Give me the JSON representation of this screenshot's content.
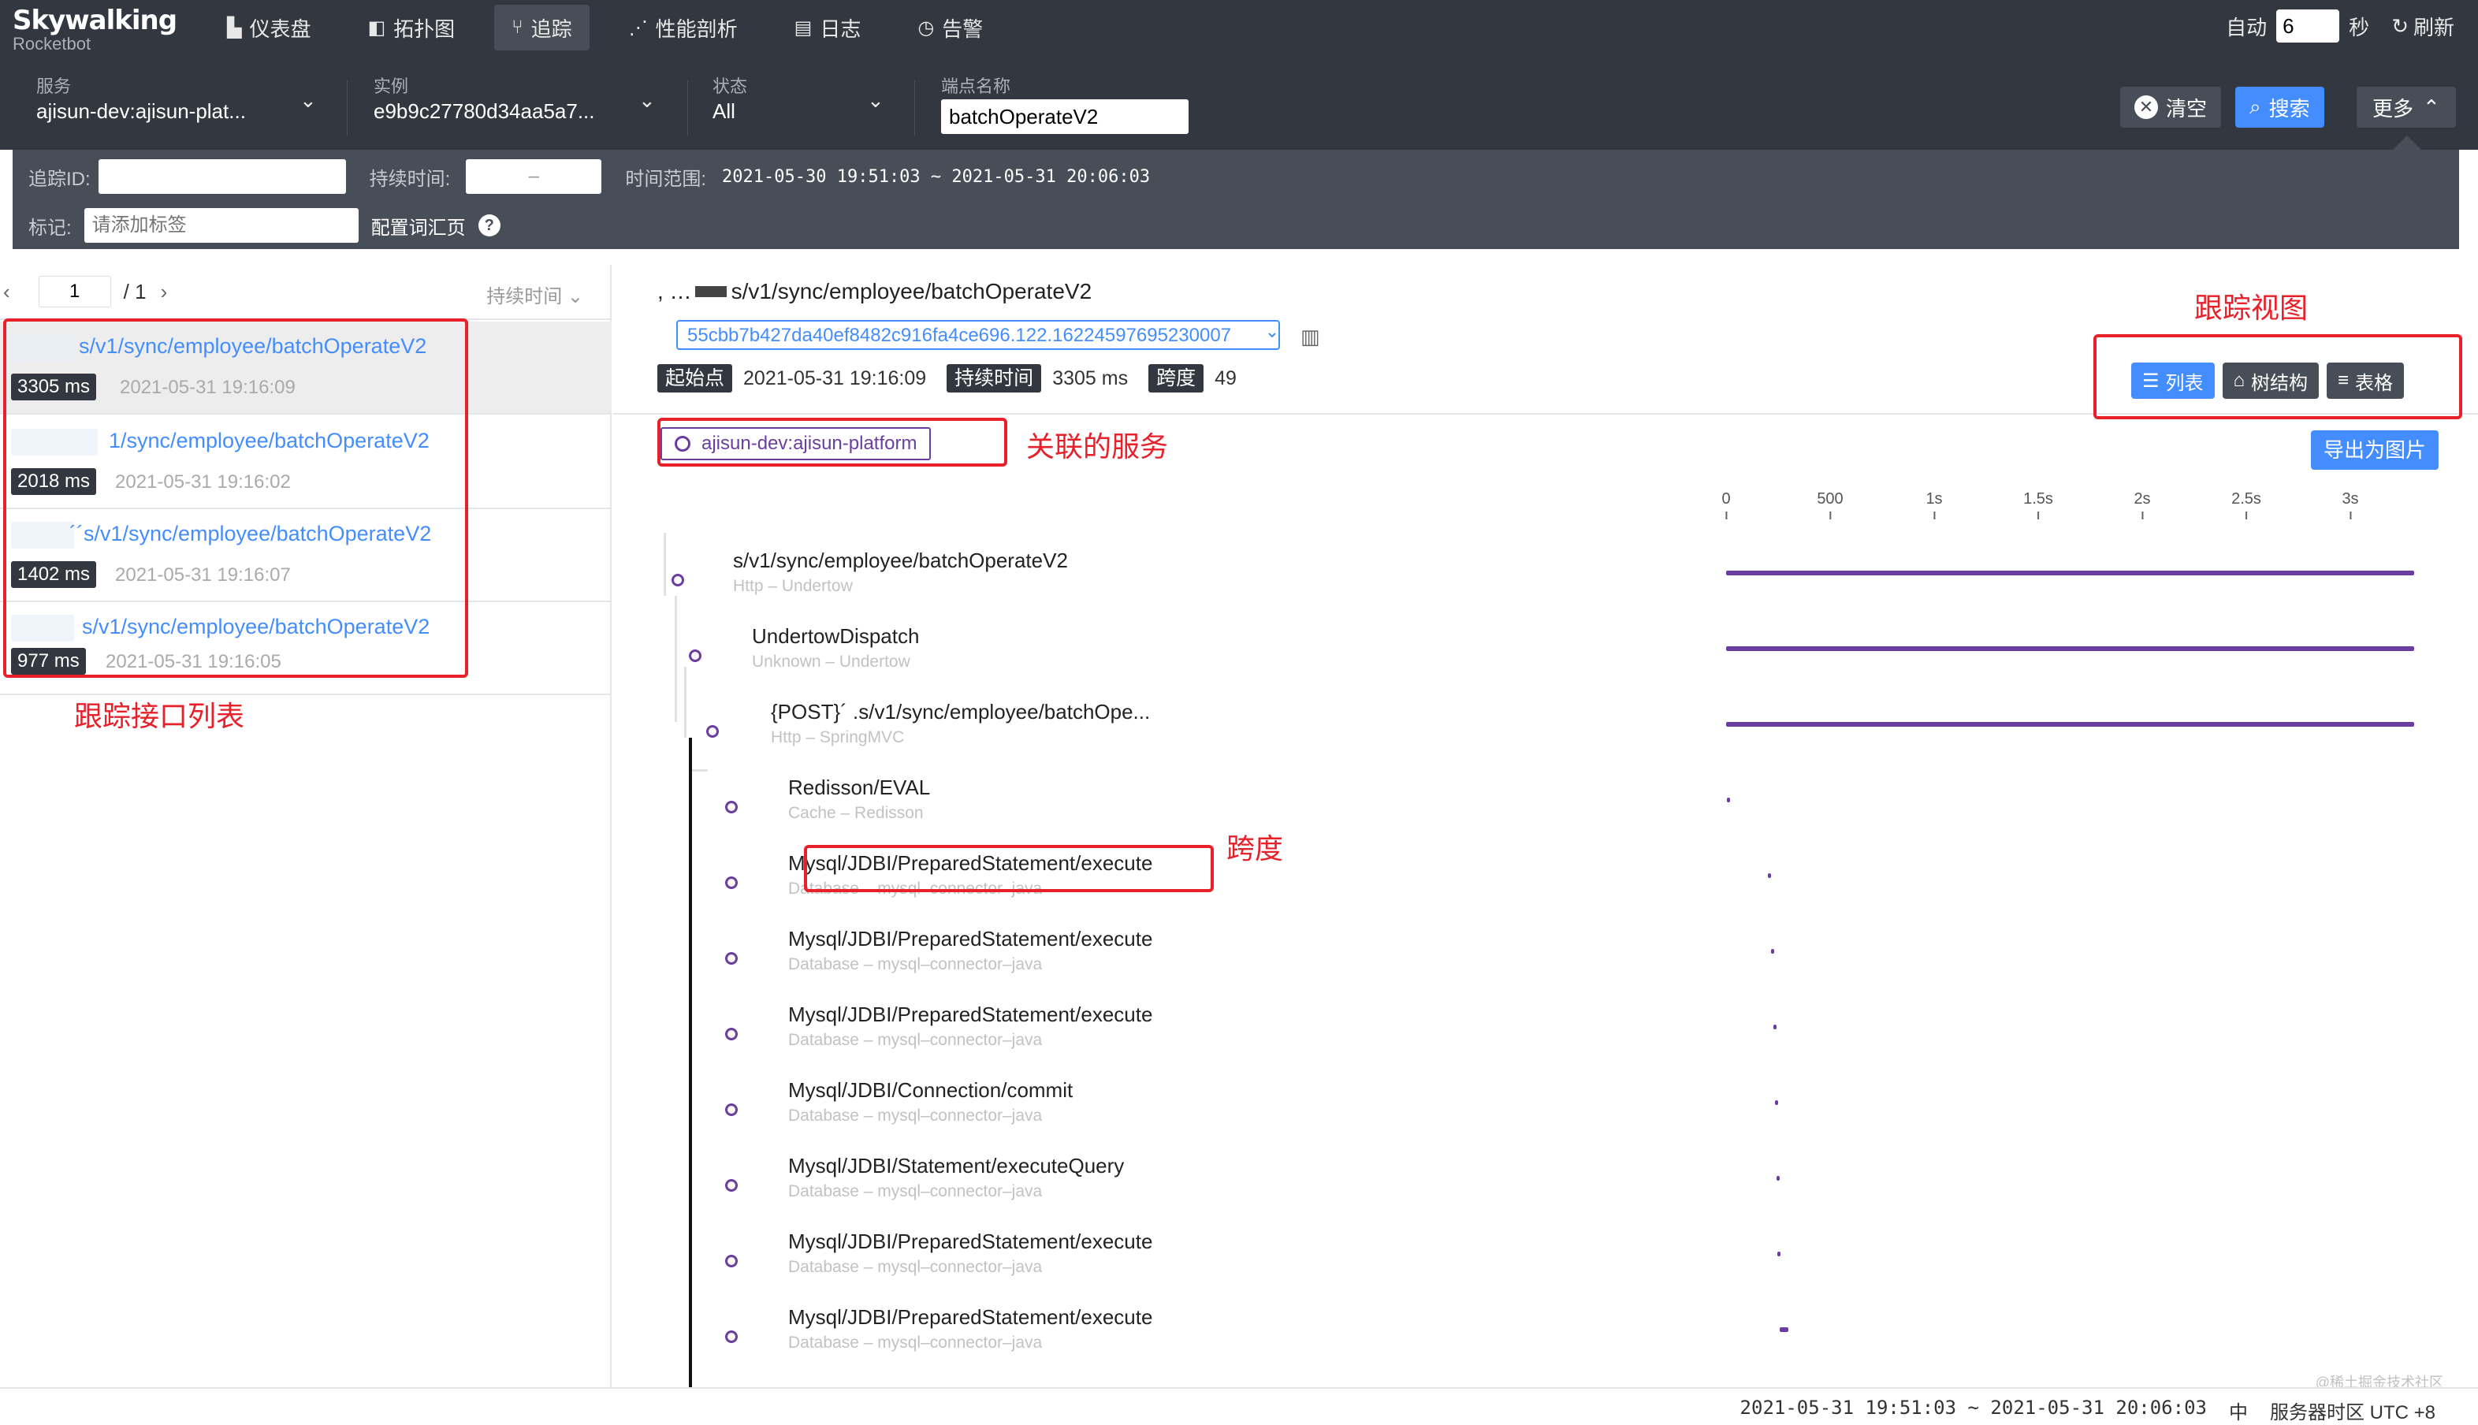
{
  "app": {
    "logo": "Skywalking",
    "logo_sub": "Rocketbot"
  },
  "nav": [
    {
      "icon": "dashboard-icon",
      "label": "仪表盘"
    },
    {
      "icon": "topology-icon",
      "label": "拓扑图"
    },
    {
      "icon": "trace-icon",
      "label": "追踪"
    },
    {
      "icon": "profile-icon",
      "label": "性能剖析"
    },
    {
      "icon": "log-icon",
      "label": "日志"
    },
    {
      "icon": "alarm-icon",
      "label": "告警"
    }
  ],
  "topright": {
    "auto_label": "自动",
    "interval": "6",
    "unit": "秒",
    "refresh": "刷新"
  },
  "filters": {
    "service_label": "服务",
    "service_value": "ajisun-dev:ajisun-plat...",
    "instance_label": "实例",
    "instance_value": "e9b9c27780d34aa5a7...",
    "status_label": "状态",
    "status_value": "All",
    "endpoint_label": "端点名称",
    "endpoint_value": "batchOperateV2",
    "clear": "清空",
    "search": "搜索",
    "more": "更多"
  },
  "conditions": {
    "trace_id_label": "追踪ID:",
    "duration_label": "持续时间:",
    "duration_sep": "–",
    "time_range_label": "时间范围:",
    "time_range": "2021-05-30 19:51:03 ~ 2021-05-31 20:06:03",
    "tag_label": "标记:",
    "tag_placeholder": "请添加标签",
    "config_vocab": "配置词汇页"
  },
  "pager": {
    "page": "1",
    "total": "/ 1",
    "sort": "持续时间"
  },
  "traces": [
    {
      "title": "s/v1/sync/employee/batchOperateV2",
      "duration": "3305 ms",
      "time": "2021-05-31 19:16:09"
    },
    {
      "title": "1/sync/employee/batchOperateV2",
      "duration": "2018 ms",
      "time": "2021-05-31 19:16:02"
    },
    {
      "title": "´´s/v1/sync/employee/batchOperateV2",
      "duration": "1402 ms",
      "time": "2021-05-31 19:16:07"
    },
    {
      "title": "s/v1/sync/employee/batchOperateV2",
      "duration": "977 ms",
      "time": "2021-05-31 19:16:05"
    }
  ],
  "detail": {
    "endpoint": "s/v1/sync/employee/batchOperateV2",
    "trace_id": "55cbb7b427da40ef8482c916fa4ce696.122.16224597695230007",
    "start_label": "起始点",
    "start": "2021-05-31 19:16:09",
    "duration_label": "持续时间",
    "duration": "3305 ms",
    "spans_label": "跨度",
    "spans": "49",
    "view_list": "列表",
    "view_tree": "树结构",
    "view_table": "表格",
    "service": "ajisun-dev:ajisun-platform",
    "export": "导出为图片"
  },
  "axis_ticks": [
    "0",
    "500",
    "1s",
    "1.5s",
    "2s",
    "2.5s",
    "3s"
  ],
  "spans": [
    {
      "name": "s/v1/sync/employee/batchOperateV2",
      "sub": "Http – Undertow",
      "start": 0,
      "end": 3305
    },
    {
      "name": "UndertowDispatch",
      "sub": "Unknown – Undertow",
      "start": 0,
      "end": 3305
    },
    {
      "name": "{POST}´ .s/v1/sync/employee/batchOpe...",
      "sub": "Http – SpringMVC",
      "start": 0,
      "end": 3305
    },
    {
      "name": "Redisson/EVAL",
      "sub": "Cache – Redisson",
      "start": 2,
      "end": 6
    },
    {
      "name": "Mysql/JDBI/PreparedStatement/execute",
      "sub": "Database – mysql–connector–java",
      "start": 200,
      "end": 210
    },
    {
      "name": "Mysql/JDBI/PreparedStatement/execute",
      "sub": "Database – mysql–connector–java",
      "start": 215,
      "end": 222
    },
    {
      "name": "Mysql/JDBI/PreparedStatement/execute",
      "sub": "Database – mysql–connector–java",
      "start": 228,
      "end": 234
    },
    {
      "name": "Mysql/JDBI/Connection/commit",
      "sub": "Database – mysql–connector–java",
      "start": 236,
      "end": 240
    },
    {
      "name": "Mysql/JDBI/Statement/executeQuery",
      "sub": "Database – mysql–connector–java",
      "start": 242,
      "end": 246
    },
    {
      "name": "Mysql/JDBI/PreparedStatement/execute",
      "sub": "Database – mysql–connector–java",
      "start": 248,
      "end": 253
    },
    {
      "name": "Mysql/JDBI/PreparedStatement/execute",
      "sub": "Database – mysql–connector–java",
      "start": 258,
      "end": 300
    }
  ],
  "annotations": {
    "trace_list": "跟踪接口列表",
    "trace_view": "跟踪视图",
    "service": "关联的服务",
    "span": "跨度"
  },
  "footer": {
    "range": "2021-05-31 19:51:03 ~ 2021-05-31 20:06:03",
    "lang": "中",
    "tz": "服务器时区 UTC +8"
  },
  "watermark": "@稀土掘金技术社区",
  "colors": {
    "nav_bg": "#333840",
    "accent": "#448dfe",
    "span": "#6a3ea1",
    "annotation": "#e8202a"
  }
}
